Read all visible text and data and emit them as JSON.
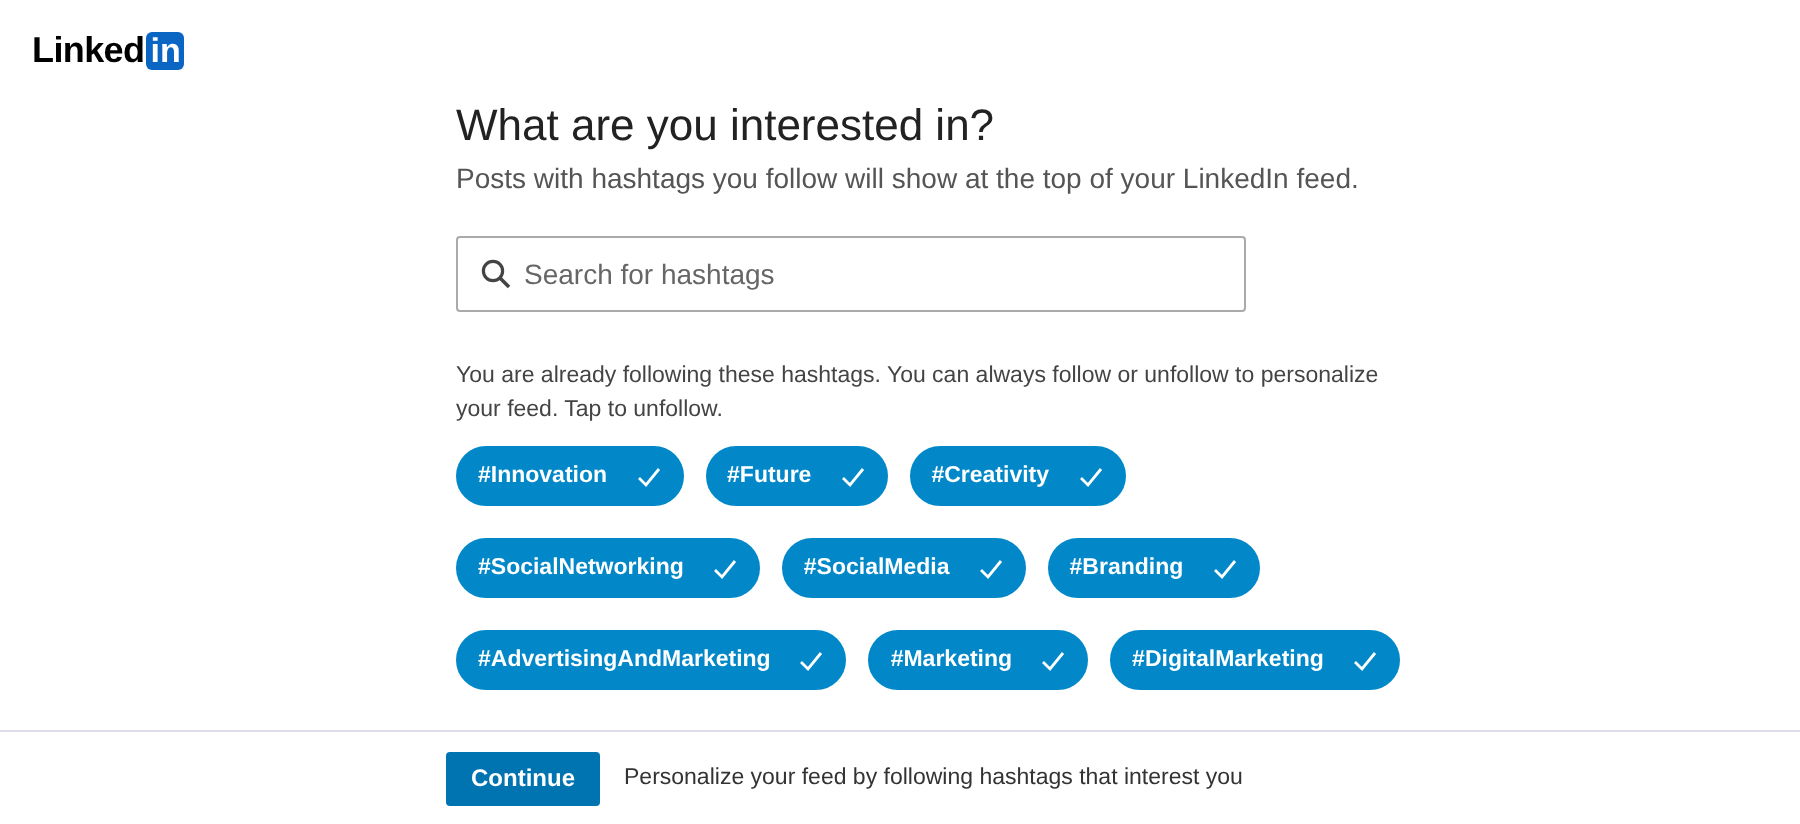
{
  "logo": {
    "text": "Linked",
    "badge": "in"
  },
  "heading": "What are you interested in?",
  "subheading": "Posts with hashtags you follow will show at the top of your LinkedIn feed.",
  "search": {
    "placeholder": "Search for hashtags"
  },
  "info": "You are already following these hashtags. You can always follow or unfollow to personalize your feed. Tap to unfollow.",
  "hashtag_rows": [
    [
      {
        "label": "#Innovation",
        "followed": true
      },
      {
        "label": "#Future",
        "followed": true
      },
      {
        "label": "#Creativity",
        "followed": true
      }
    ],
    [
      {
        "label": "#SocialNetworking",
        "followed": true
      },
      {
        "label": "#SocialMedia",
        "followed": true
      },
      {
        "label": "#Branding",
        "followed": true
      }
    ],
    [
      {
        "label": "#AdvertisingAndMarketing",
        "followed": true
      },
      {
        "label": "#Marketing",
        "followed": true
      },
      {
        "label": "#DigitalMarketing",
        "followed": true
      }
    ]
  ],
  "footer": {
    "button": "Continue",
    "text": "Personalize your feed by following hashtags that interest you"
  }
}
